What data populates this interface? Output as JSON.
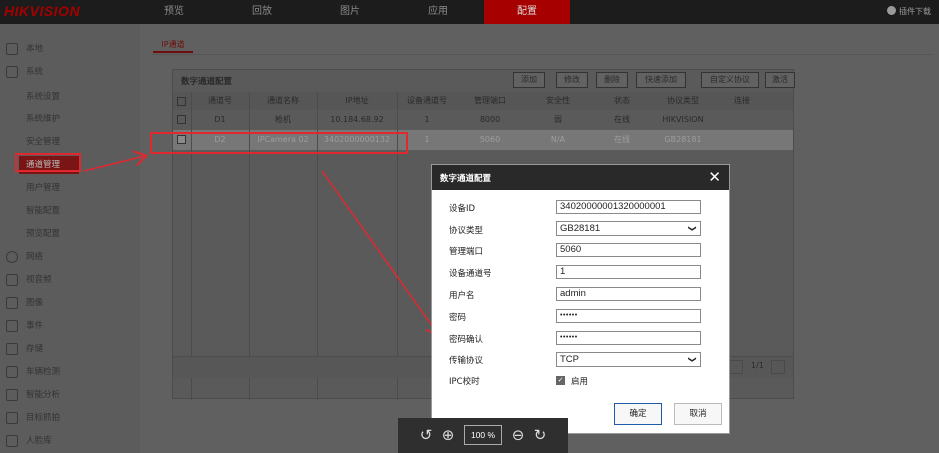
{
  "app": {
    "logo": "HIKVISION",
    "plugin_label": "插件下载"
  },
  "nav": [
    "预览",
    "回放",
    "图片",
    "应用",
    "配置"
  ],
  "sidebar": {
    "items": [
      {
        "label": "本地",
        "icon": "monitor-icon"
      },
      {
        "label": "系统",
        "icon": "system-icon"
      },
      {
        "label": "网络",
        "icon": "network-icon"
      },
      {
        "label": "视音频",
        "icon": "audio-video-icon"
      },
      {
        "label": "图像",
        "icon": "image-icon"
      },
      {
        "label": "事件",
        "icon": "event-icon"
      },
      {
        "label": "存储",
        "icon": "storage-icon"
      },
      {
        "label": "车辆检测",
        "icon": "vehicle-icon"
      },
      {
        "label": "智能分析",
        "icon": "analysis-icon"
      },
      {
        "label": "目标抓拍",
        "icon": "capture-icon"
      },
      {
        "label": "人脸库",
        "icon": "face-icon"
      }
    ],
    "system_sub": [
      "系统设置",
      "系统维护",
      "安全管理",
      "通道管理",
      "用户管理",
      "智能配置",
      "预览配置"
    ]
  },
  "content": {
    "tab": "IP通道"
  },
  "panel": {
    "title": "数字通道配置",
    "toolbar": [
      "添加",
      "修改",
      "删除",
      "快速添加",
      "自定义协议",
      "激活"
    ],
    "columns": [
      "通道号",
      "通道名称",
      "IP地址",
      "设备通道号",
      "管理端口",
      "安全性",
      "状态",
      "协议类型",
      "连接"
    ],
    "rows": [
      [
        "D1",
        "枪机",
        "10.184.68.92",
        "1",
        "8000",
        "弱",
        "在线",
        "HIKVISION",
        ""
      ],
      [
        "D2",
        "IPCamera 02",
        "3402000000132",
        "1",
        "5060",
        "N/A",
        "在线",
        "GB28181",
        ""
      ]
    ],
    "pagination": "1/1"
  },
  "dialog": {
    "title": "数字通道配置",
    "fields": [
      {
        "label": "设备ID",
        "value": "34020000001320000001"
      },
      {
        "label": "协议类型",
        "value": "GB28181"
      },
      {
        "label": "管理端口",
        "value": "5060"
      },
      {
        "label": "设备通道号",
        "value": "1"
      },
      {
        "label": "用户名",
        "value": "admin"
      },
      {
        "label": "密码",
        "value": "••••••"
      },
      {
        "label": "密码确认",
        "value": "••••••"
      },
      {
        "label": "传输协议",
        "value": "TCP"
      }
    ],
    "ipc_label": "IPC校时",
    "ipc_enable": "启用",
    "ok": "确定",
    "cancel": "取消"
  },
  "zoom": {
    "value": "100 %"
  },
  "colors": {
    "accent": "#a60000",
    "annotation": "#e0282f",
    "dialog_header": "#292929"
  }
}
